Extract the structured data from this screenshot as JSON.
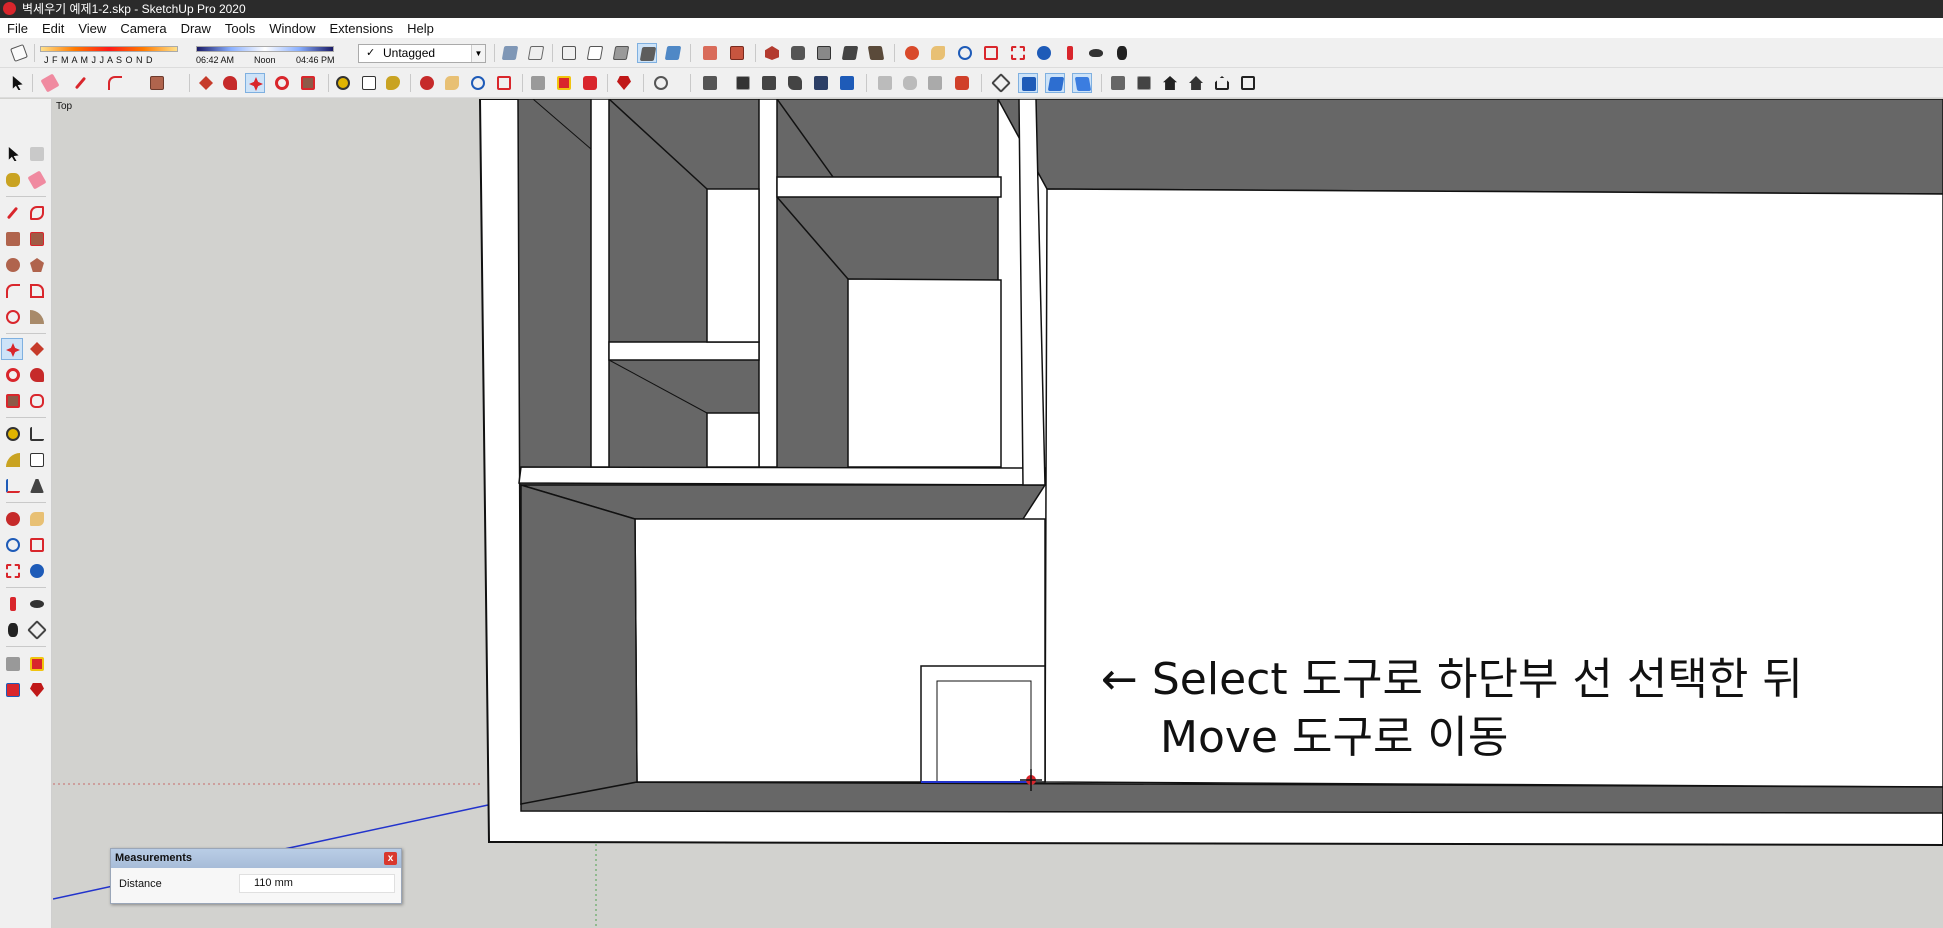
{
  "window": {
    "title": "벽세우기 예제1-2.skp - SketchUp Pro 2020"
  },
  "menu": [
    "File",
    "Edit",
    "View",
    "Camera",
    "Draw",
    "Tools",
    "Window",
    "Extensions",
    "Help"
  ],
  "shadow": {
    "months": "J F M A M J J A S O N D",
    "time_start": "06:42 AM",
    "time_mid": "Noon",
    "time_end": "04:46 PM"
  },
  "tag_dropdown": {
    "check": "✓",
    "selected": "Untagged"
  },
  "scene": {
    "view_label": "Top"
  },
  "annotation": {
    "line1": "← Select 도구로 하단부 선 선택한 뒤",
    "line2": "Move 도구로 이동"
  },
  "measurements": {
    "title": "Measurements",
    "close": "x",
    "label": "Distance",
    "value": "110 mm"
  },
  "toolbar_icons": {
    "row1": [
      "eraser-icon",
      "shadow-settings-icon",
      "tag-dropdown",
      "wireframe-icon",
      "hidden-line-icon",
      "shaded-icon",
      "shaded-textures-icon",
      "monochrome-icon",
      "xray-icon",
      "back-edges-icon",
      "section-plane-icon",
      "section-cut-icon",
      "orbit-icon",
      "pan-icon",
      "zoom-icon",
      "zoom-window-icon",
      "zoom-extents-icon",
      "previous-view-icon",
      "position-camera-icon",
      "look-around-icon",
      "walk-icon"
    ],
    "row2": [
      "select-icon",
      "eraser-icon",
      "line-icon",
      "arc-icon",
      "rectangle-icon",
      "push-pull-icon",
      "follow-me-icon",
      "move-icon",
      "rotate-icon",
      "scale-icon",
      "tape-measure-icon",
      "text-icon",
      "paint-bucket-icon",
      "orbit-icon",
      "pan-icon",
      "zoom-icon",
      "zoom-extents-icon",
      "warehouse-icon",
      "extension-icon",
      "ruby-icon",
      "user-icon",
      "iso-view-icon",
      "top-view-icon",
      "front-view-icon",
      "right-view-icon",
      "back-view-icon",
      "left-view-icon",
      "make-component-icon",
      "outer-shell-icon",
      "intersect-icon",
      "union-icon",
      "subtract-icon",
      "section-plane-icon",
      "display-section-icon",
      "house-icon",
      "home-icon",
      "tag-icon"
    ]
  },
  "colors": {
    "accent": "#1e5bb8",
    "title_bg": "#2b2b2b",
    "wall_dark": "#676767",
    "wall_white": "#ffffff",
    "ground": "#d2d2cf"
  }
}
